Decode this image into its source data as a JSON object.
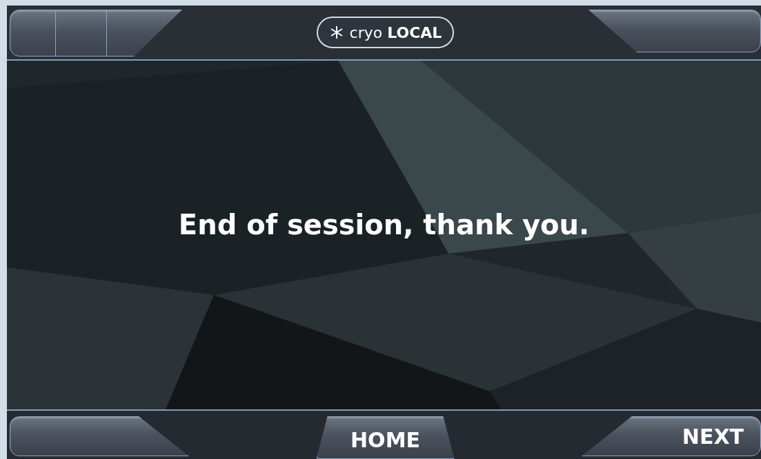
{
  "header": {
    "logo": "cryo **LOCAL**"
  },
  "message": "End of session, thank you.",
  "footer": {
    "buttons": [
      {
        "label": "HOME",
        "kind": "center"
      },
      {
        "label": "NEXT",
        "kind": "right"
      }
    ]
  }
}
